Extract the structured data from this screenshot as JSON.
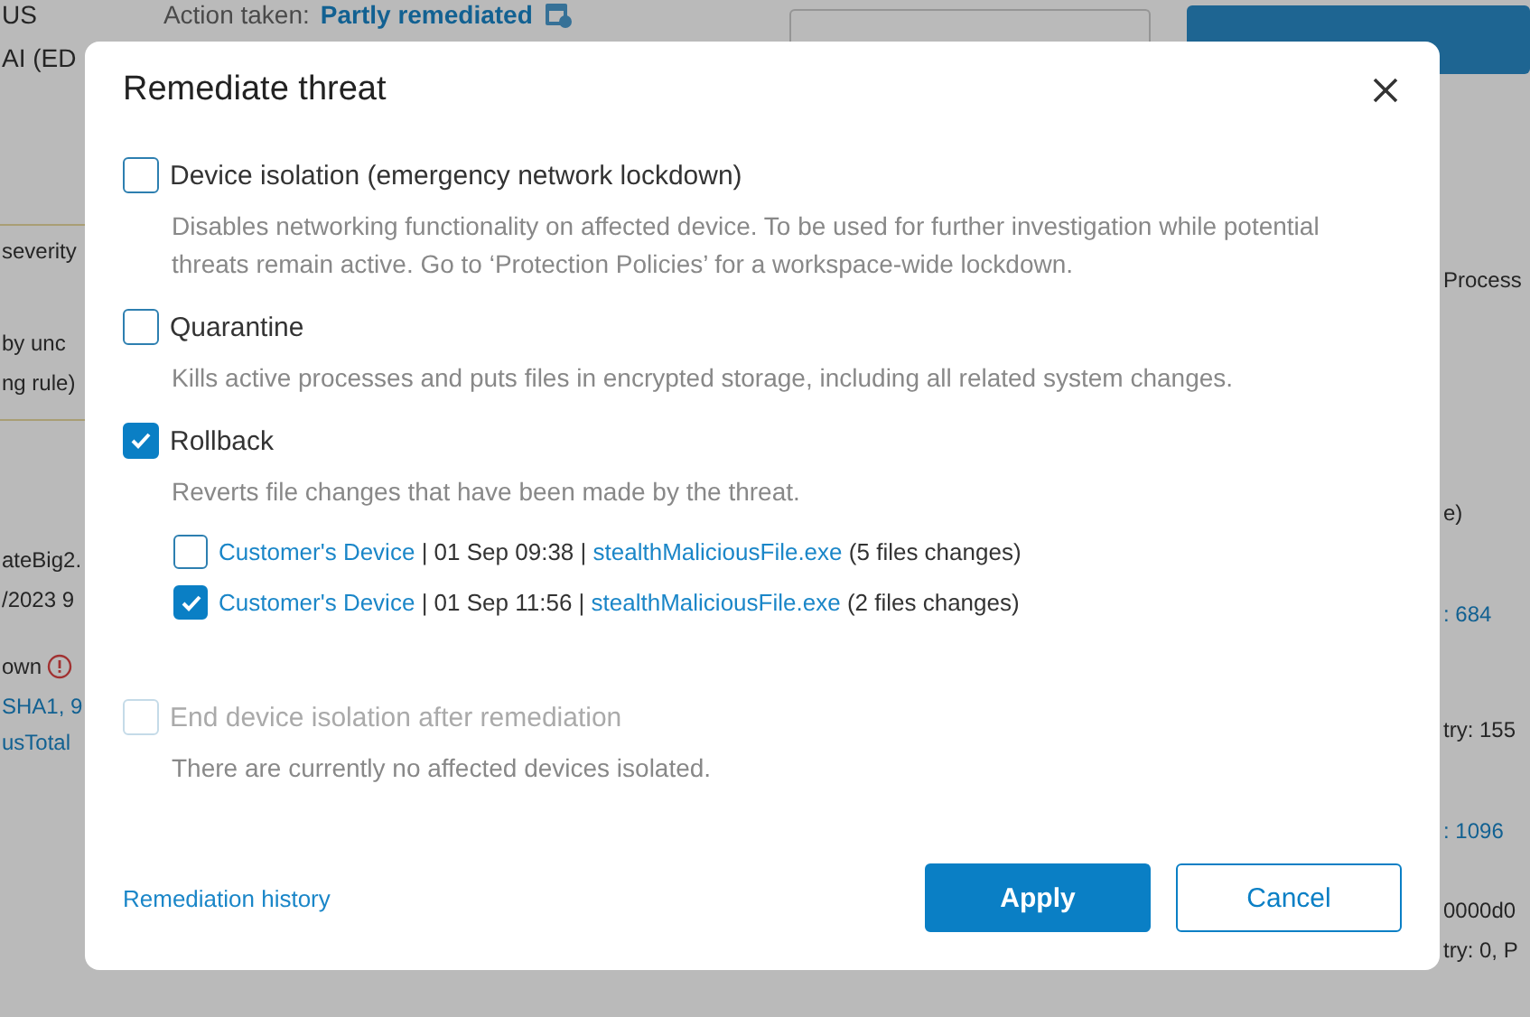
{
  "background": {
    "header": {
      "status_fragment": "US",
      "action_label": "Action taken:",
      "action_value": "Partly remediated",
      "subtitle_fragment": "AI (ED"
    },
    "left_fragments": [
      {
        "text": "severity",
        "kind": "text"
      },
      {
        "text": "by unc",
        "kind": "text"
      },
      {
        "text": "ng rule)",
        "kind": "text"
      },
      {
        "text": "ateBig2.",
        "kind": "text"
      },
      {
        "text": "/2023 9",
        "kind": "text"
      },
      {
        "text": "own",
        "kind": "warning"
      },
      {
        "text": "SHA1, 9",
        "kind": "link"
      },
      {
        "text": "usTotal",
        "kind": "link"
      }
    ],
    "right_fragments": [
      {
        "text": "Process",
        "kind": "text"
      },
      {
        "text": "e)",
        "kind": "text"
      },
      {
        "text": ": 684",
        "kind": "link"
      },
      {
        "text": "try: 155",
        "kind": "text"
      },
      {
        "text": ": 1096",
        "kind": "link"
      },
      {
        "text": "0000d0",
        "kind": "text"
      },
      {
        "text": "try: 0, P",
        "kind": "text"
      }
    ]
  },
  "dialog": {
    "title": "Remediate threat",
    "options": [
      {
        "label": "Device isolation (emergency network lockdown)",
        "checked": false,
        "disabled": false,
        "description": "Disables networking functionality on affected device. To be used for further investigation while potential threats remain active. Go to ‘Protection Policies’ for a workspace-wide lockdown."
      },
      {
        "label": "Quarantine",
        "checked": false,
        "disabled": false,
        "description": "Kills active processes and puts files in encrypted storage, including all related system changes."
      },
      {
        "label": "Rollback",
        "checked": true,
        "disabled": false,
        "description": "Reverts file changes that have been made by the threat.",
        "children": [
          {
            "device": "Customer's Device",
            "time": "| 01 Sep 09:38 |",
            "file": "stealthMaliciousFile.exe",
            "note": "(5 files changes)",
            "checked": false
          },
          {
            "device": "Customer's Device",
            "time": "| 01 Sep 11:56 |",
            "file": "stealthMaliciousFile.exe",
            "note": "(2 files changes)",
            "checked": true
          }
        ]
      },
      {
        "label": "End device isolation after remediation",
        "checked": false,
        "disabled": true,
        "description": "There are currently no affected devices isolated."
      }
    ],
    "history_link": "Remediation history",
    "apply_button": "Apply",
    "cancel_button": "Cancel"
  }
}
